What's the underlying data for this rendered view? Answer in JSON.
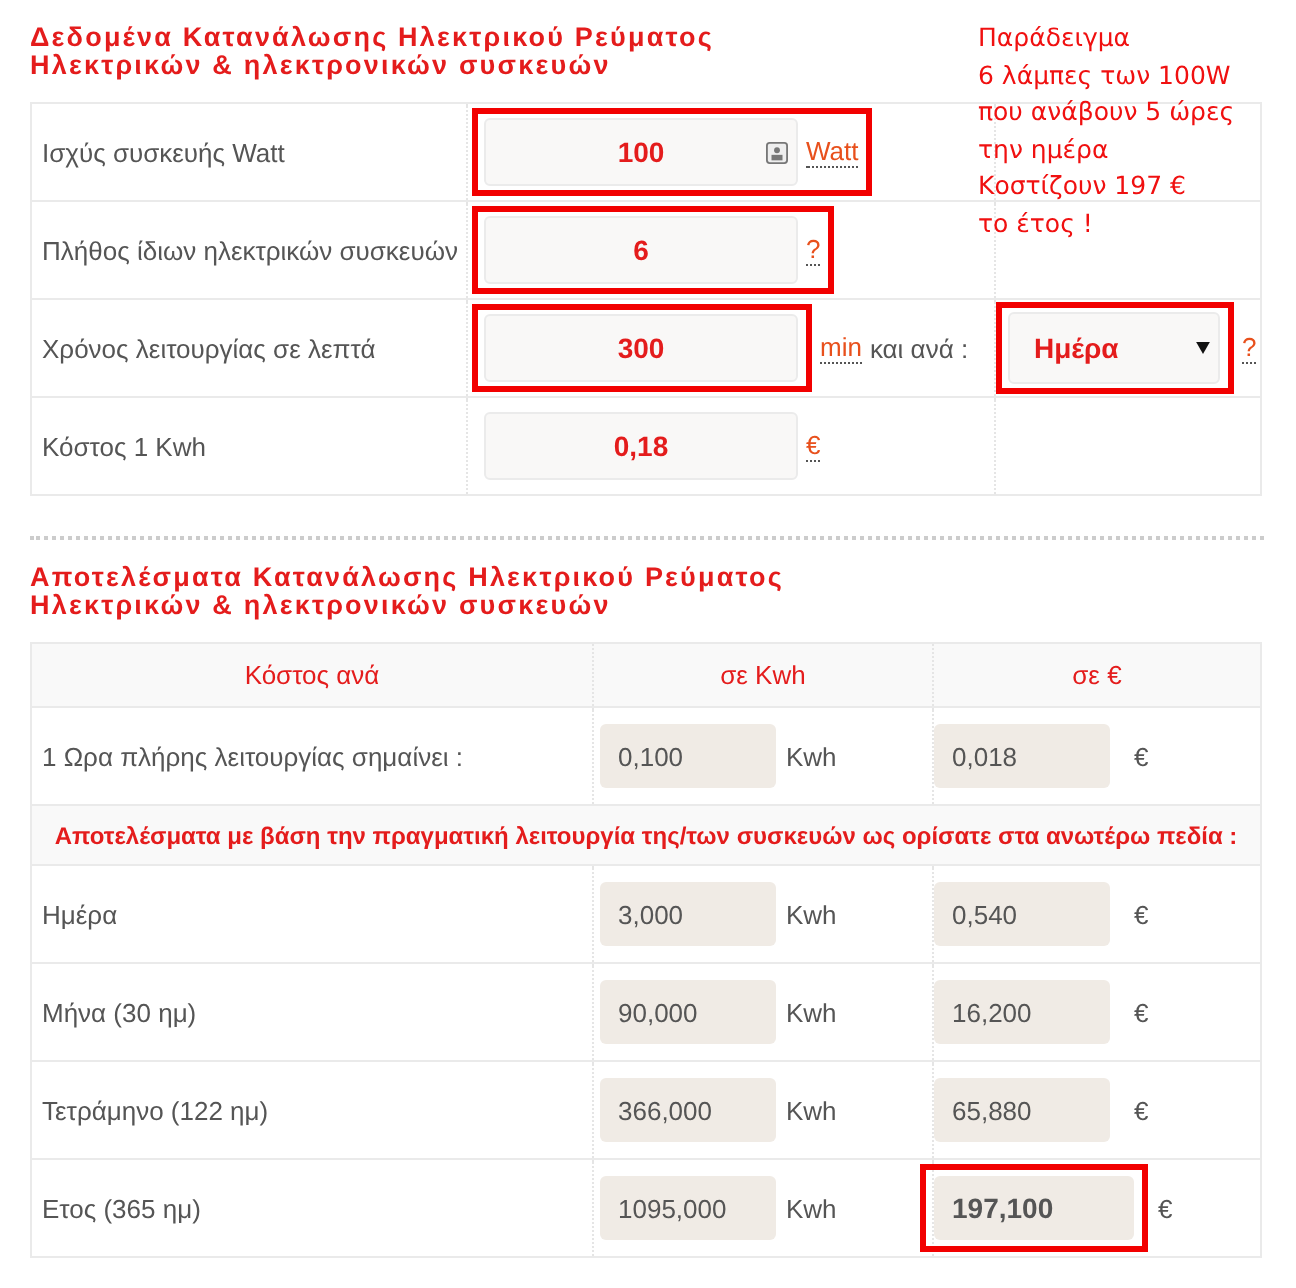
{
  "inputs": {
    "title": [
      "Δεδομένα Κατανάλωσης Ηλεκτρικού Ρεύματος",
      "Ηλεκτρικών & ηλεκτρονικών συσκευών"
    ],
    "rows": [
      {
        "kind": "input",
        "label": "Ισχύς συσκευής Watt",
        "value": "100",
        "card_icon": true,
        "unit": "Watt",
        "highlighted": true
      },
      {
        "kind": "input",
        "label": "Πλήθος ίδιων ηλεκτρικών συσκευών",
        "value": "6",
        "card_icon": false,
        "unit": "?",
        "highlighted": true
      },
      {
        "kind": "period",
        "label": "Χρόνος λειτουργίας σε λεπτά",
        "value": "300",
        "card_icon": false,
        "unit": "min",
        "highlighted": true,
        "connector": "και ανά :",
        "select": {
          "value": "Ημέρα",
          "highlighted": true
        },
        "help": "?"
      },
      {
        "kind": "input",
        "label": "Κόστος 1 Kwh",
        "value": "0,18",
        "card_icon": false,
        "unit": "€",
        "highlighted": false
      }
    ]
  },
  "note": [
    "Παράδειγμα",
    "6 λάμπες των 100W",
    "που ανάβουν 5 ώρες",
    "την ημέρα",
    "Κοστίζουν 197 €",
    "το έτος !"
  ],
  "results": {
    "title": [
      "Αποτελέσματα Κατανάλωσης Ηλεκτρικού Ρεύματος",
      "Ηλεκτρικών & ηλεκτρονικών συσκευών"
    ],
    "columns": [
      "Κόστος ανά",
      "σε Kwh",
      "σε €"
    ],
    "rows": [
      {
        "kind": "data",
        "label": "1 Ωρα πλήρης λειτουργίας σημαίνει :",
        "kwh": "0,100",
        "kwh_unit": "Kwh",
        "eur": "0,018",
        "eur_unit": "€",
        "highlighted": false
      },
      {
        "kind": "section",
        "label": "Αποτελέσματα με βάση την πραγματική λειτουργία της/των συσκευών ως ορίσατε στα ανωτέρω πεδία :"
      },
      {
        "kind": "data",
        "label": "Ημέρα",
        "kwh": "3,000",
        "kwh_unit": "Kwh",
        "eur": "0,540",
        "eur_unit": "€",
        "highlighted": false
      },
      {
        "kind": "data",
        "label": "Μήνα (30 ημ)",
        "kwh": "90,000",
        "kwh_unit": "Kwh",
        "eur": "16,200",
        "eur_unit": "€",
        "highlighted": false
      },
      {
        "kind": "data",
        "label": "Τετράμηνο (122 ημ)",
        "kwh": "366,000",
        "kwh_unit": "Kwh",
        "eur": "65,880",
        "eur_unit": "€",
        "highlighted": false
      },
      {
        "kind": "data",
        "label": "Ετος (365 ημ)",
        "kwh": "1095,000",
        "kwh_unit": "Kwh",
        "eur": "197,100",
        "eur_unit": "€",
        "highlighted": true
      }
    ]
  }
}
